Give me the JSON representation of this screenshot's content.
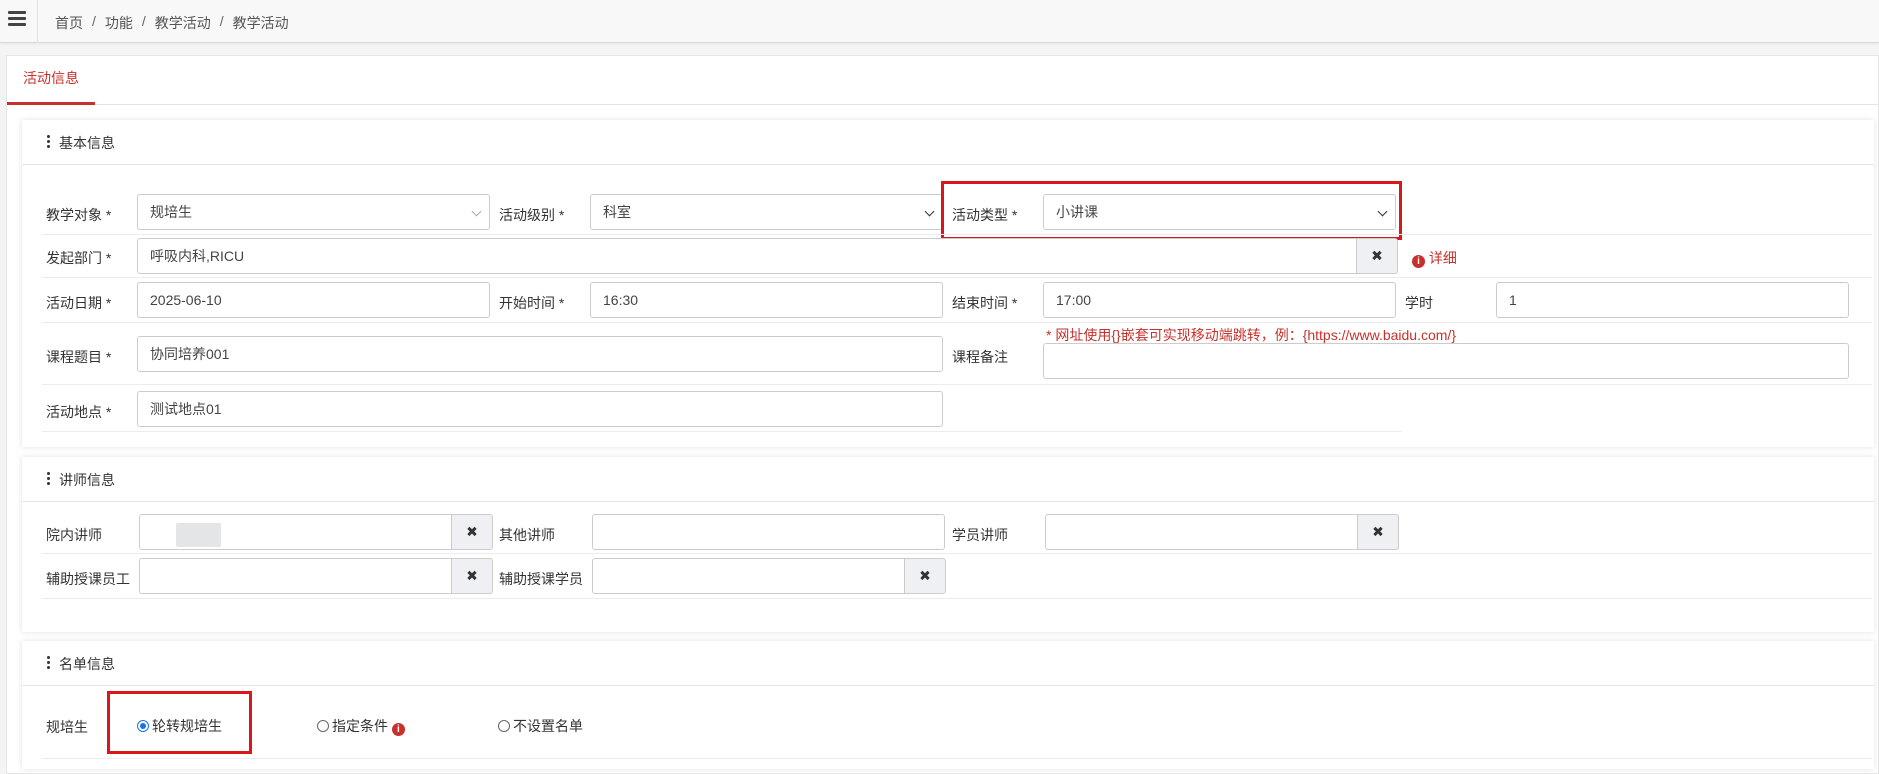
{
  "breadcrumb": [
    "首页",
    "功能",
    "教学活动",
    "教学活动"
  ],
  "tabs": {
    "active": "活动信息"
  },
  "basic": {
    "title": "基本信息",
    "teaching_target": {
      "label": "教学对象 *",
      "value": "规培生"
    },
    "activity_level": {
      "label": "活动级别 *",
      "value": "科室"
    },
    "activity_type": {
      "label": "活动类型 *",
      "value": "小讲课"
    },
    "dept": {
      "label": "发起部门 *",
      "value": "呼吸内科,RICU",
      "detail": "详细"
    },
    "date": {
      "label": "活动日期 *",
      "value": "2025-06-10"
    },
    "start_time": {
      "label": "开始时间 *",
      "value": "16:30"
    },
    "end_time": {
      "label": "结束时间 *",
      "value": "17:00"
    },
    "hours": {
      "label": "学时",
      "value": "1"
    },
    "course_title": {
      "label": "课程题目 *",
      "value": "协同培养001"
    },
    "course_note": {
      "label": "课程备注",
      "value": "",
      "hint": "* 网址使用{}嵌套可实现移动端跳转，例：{https://www.baidu.com/}"
    },
    "location": {
      "label": "活动地点 *",
      "value": "测试地点01"
    }
  },
  "teachers": {
    "title": "讲师信息",
    "internal": {
      "label": "院内讲师",
      "value": ""
    },
    "other": {
      "label": "其他讲师",
      "value": ""
    },
    "student": {
      "label": "学员讲师",
      "value": ""
    },
    "assist_staff": {
      "label": "辅助授课员工",
      "value": ""
    },
    "assist_student": {
      "label": "辅助授课学员",
      "value": ""
    }
  },
  "roster": {
    "title": "名单信息",
    "label": "规培生",
    "options": [
      "轮转规培生",
      "指定条件",
      "不设置名单"
    ],
    "selected": "轮转规培生"
  },
  "colors": {
    "accent": "#c9302c",
    "highlight_box": "#d9171b",
    "radio_on": "#1a73e8"
  }
}
